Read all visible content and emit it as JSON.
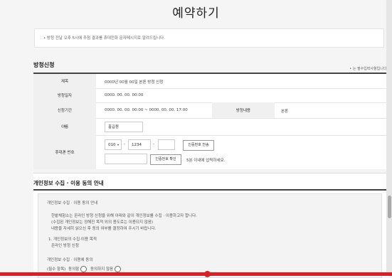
{
  "page_title": "예약하기",
  "notice": "• 방청 전날 오후 5시에 추첨 결과를 휴대전화 문자메시지로 알려드립니다.",
  "section_title": "방청신청",
  "required_note": "• 는 필수입력사항입니다.",
  "form": {
    "subject_label": "제목",
    "subject_value": "0000년 00월 00일 본론 방청 신청",
    "date_label": "방청일자",
    "date_value": "0000. 00. 00. 00:00",
    "period_label": "신청기간",
    "period_value": "0000. 00. 00. 00:00 ~ 0000. 00. 00. 17:00",
    "content_label": "방청내용",
    "content_value": "본론",
    "name_label": "이름",
    "name_value": "홍길동",
    "phone_label": "휴대폰 번호",
    "phone_prefix": "010",
    "phone_sep1": "-",
    "phone_mid": "1234",
    "phone_sep2": "-",
    "send_code_label": "인증번호 전송",
    "verify_label": "인증번호 확인",
    "verify_hint": "5분 이내에 입력하세요."
  },
  "privacy": {
    "title": "개인정보 수집 · 이용 동의 안내",
    "lines": [
      "개인정보 수집 · 이용 동의 안내",
      "한밭체험소는 온라인 방청 신청을 위해 아래와 같이 개인정보를 수집 · 이용하고자 합니다.",
      "(수집된 개인정보는 정해진 목적 외의 용도로는 이용되지 않음)",
      "내용을 자세히 읽으신 후 동의 여부를 결정하여 주시기 바랍니다.",
      "1. 개인정보의 수집·이용 목적",
      "온라인 방청 신청",
      "개인정보 수집 · 이용에 동의"
    ],
    "agree_prefix": "(필수 항목)",
    "agree_yes": "동의함",
    "agree_no": "동의하지 않음"
  }
}
